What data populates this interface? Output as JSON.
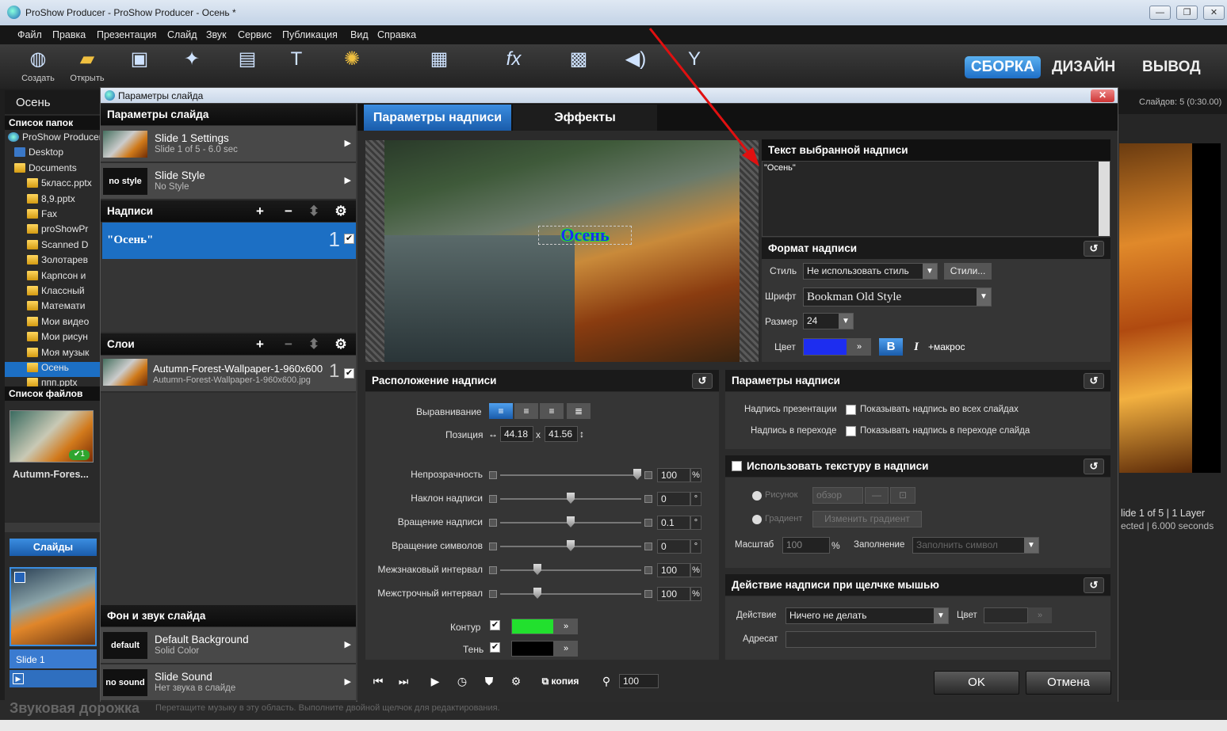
{
  "window": {
    "title": "ProShow Producer - ProShow Producer - Осень *"
  },
  "menu": [
    "Файл",
    "Правка",
    "Презентация",
    "Слайд",
    "Звук",
    "Сервис",
    "Публикация",
    "Вид",
    "Справка"
  ],
  "toolbar": {
    "buttons": [
      "Создать",
      "Открыть",
      "Сохранить",
      "Мастер",
      "Слайд",
      "Надпись",
      "Переходы",
      "Параметры слайда",
      "Эффекты",
      "Презентация",
      "Музыка",
      "Синхронизация"
    ],
    "modes": {
      "build": "СБОРКА",
      "design": "ДИЗАЙН",
      "output": "ВЫВОД"
    }
  },
  "project": {
    "name": "Осень",
    "slides_count": "Слайдов: 5 (0:30.00)"
  },
  "left": {
    "folders_header": "Список папок",
    "tree": [
      "ProShow Producer",
      "Desktop",
      "Documents",
      "5класс.pptx",
      "8,9.pptx",
      "Fax",
      "proShowPr",
      "Scanned D",
      "Золотарев",
      "Карпсон и",
      "Классный",
      "Математи",
      "Мои видео",
      "Мои рисун",
      "Моя музык",
      "Осень",
      "ппп.pptx"
    ],
    "files_header": "Список файлов",
    "file_name": "Autumn-Fores...",
    "slides_tab": "Слайды",
    "slide_label": "Slide 1"
  },
  "right": {
    "slide_info": "lide 1 of 5  |  1 Layer",
    "selected_info": "ected  |  6.000 seconds"
  },
  "bottom": {
    "audio_title": "Звуковая дорожка",
    "audio_hint": "Перетащите музыку в эту область. Выполните двойной щелчок для редактирования."
  },
  "dialog": {
    "title": "Параметры слайда",
    "slide_params_header": "Параметры слайда",
    "slide_settings": {
      "title": "Slide 1 Settings",
      "sub": "Slide 1 of 5 - 6.0 sec"
    },
    "slide_style": {
      "thumb": "no style",
      "title": "Slide Style",
      "sub": "No Style"
    },
    "captions_header": "Надписи",
    "caption_item": {
      "text": "\"Осень\"",
      "num": "1"
    },
    "layers_header": "Слои",
    "layer_item": {
      "title": "Autumn-Forest-Wallpaper-1-960x600",
      "sub": "Autumn-Forest-Wallpaper-1-960x600.jpg",
      "num": "1"
    },
    "bg_header": "Фон и звук слайда",
    "bg_item": {
      "thumb": "default",
      "title": "Default Background",
      "sub": "Solid Color"
    },
    "sound_item": {
      "thumb": "no sound",
      "title": "Slide Sound",
      "sub": "Нет звука в слайде"
    },
    "tabs": [
      "Параметры надписи",
      "Эффекты"
    ],
    "preview_caption": "Осень",
    "selected_text_header": "Текст выбранной надписи",
    "selected_text": "\"Осень\"",
    "format_header": "Формат надписи",
    "format": {
      "style_label": "Стиль",
      "style_value": "Не использовать стиль",
      "styles_btn": "Стили...",
      "font_label": "Шрифт",
      "font_value": "Bookman Old Style",
      "size_label": "Размер",
      "size_value": "24",
      "color_label": "Цвет",
      "color_value": "#1d2df0",
      "bold": "B",
      "italic": "I",
      "macro": "+макрос"
    },
    "placement_header": "Расположение надписи",
    "placement": {
      "align_label": "Выравнивание",
      "pos_label": "Позиция",
      "pos_x": "44.18",
      "pos_sep": "x",
      "pos_y": "41.56",
      "sliders": [
        {
          "label": "Непрозрачность",
          "value": "100",
          "unit": "%",
          "pos": 1.0
        },
        {
          "label": "Наклон надписи",
          "value": "0",
          "unit": "°",
          "pos": 0.5
        },
        {
          "label": "Вращение надписи",
          "value": "0.1",
          "unit": "°",
          "pos": 0.5
        },
        {
          "label": "Вращение символов",
          "value": "0",
          "unit": "°",
          "pos": 0.5
        },
        {
          "label": "Межзнаковый интервал",
          "value": "100",
          "unit": "%",
          "pos": 0.25
        },
        {
          "label": "Межстрочный интервал",
          "value": "100",
          "unit": "%",
          "pos": 0.25
        }
      ],
      "outline_label": "Контур",
      "outline_color": "#22e02e",
      "shadow_label": "Тень",
      "shadow_color": "#000000"
    },
    "caption_params_header": "Параметры надписи",
    "caption_params": {
      "pres_label": "Надпись презентации",
      "pres_check": "Показывать надпись во всех слайдах",
      "trans_label": "Надпись в переходе",
      "trans_check": "Показывать надпись в переходе слайда"
    },
    "texture_header": "Использовать текстуру в надписи",
    "texture": {
      "picture": "Рисунок",
      "browse": "обзор",
      "gradient": "Градиент",
      "change_gradient": "Изменить градиент",
      "scale_label": "Масштаб",
      "scale_value": "100",
      "scale_unit": "%",
      "fill_label": "Заполнение",
      "fill_value": "Заполнить символ"
    },
    "action_header": "Действие надписи при щелчке мышью",
    "action": {
      "action_label": "Действие",
      "action_value": "Ничего не делать",
      "color_label": "Цвет",
      "target_label": "Адресат"
    },
    "player": {
      "copy": "копия",
      "zoom": "100"
    },
    "ok": "OK",
    "cancel": "Отмена"
  }
}
